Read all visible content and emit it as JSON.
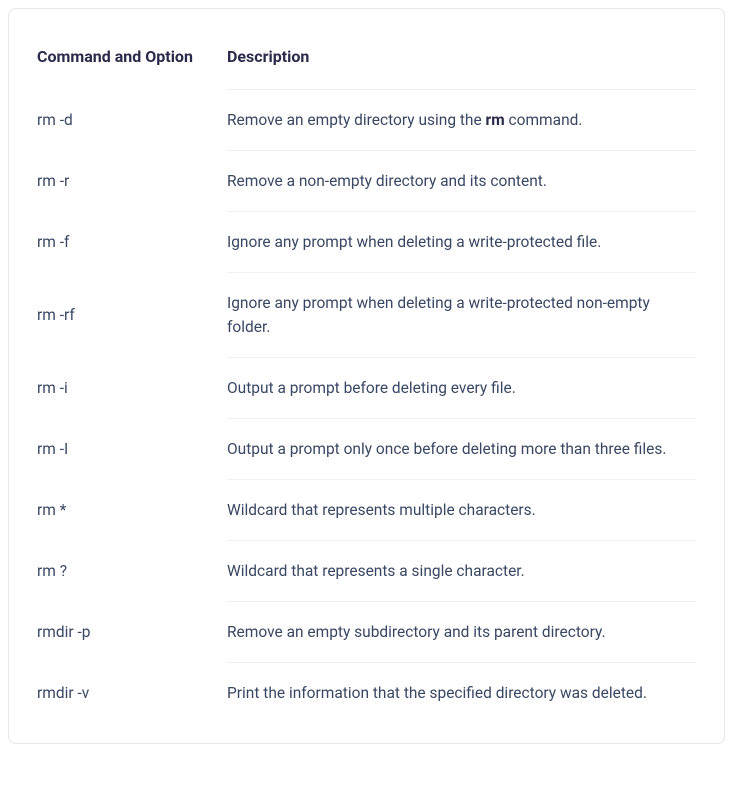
{
  "headers": {
    "command": "Command and Option",
    "description": "Description"
  },
  "rows": [
    {
      "command": "rm -d",
      "desc_pre": "Remove an empty directory using the ",
      "desc_bold": "rm",
      "desc_post": " command."
    },
    {
      "command": "rm -r",
      "desc_pre": "Remove a non-empty directory and its content.",
      "desc_bold": "",
      "desc_post": ""
    },
    {
      "command": "rm -f",
      "desc_pre": "Ignore any prompt when deleting a write-protected file.",
      "desc_bold": "",
      "desc_post": ""
    },
    {
      "command": "rm -rf",
      "desc_pre": "Ignore any prompt when deleting a write-protected non-empty folder.",
      "desc_bold": "",
      "desc_post": ""
    },
    {
      "command": "rm -i",
      "desc_pre": "Output a prompt before deleting every file.",
      "desc_bold": "",
      "desc_post": ""
    },
    {
      "command": "rm -I",
      "desc_pre": "Output a prompt only once before deleting more than three files.",
      "desc_bold": "",
      "desc_post": ""
    },
    {
      "command": "rm *",
      "desc_pre": "Wildcard that represents multiple characters.",
      "desc_bold": "",
      "desc_post": ""
    },
    {
      "command": "rm ?",
      "desc_pre": "Wildcard that represents a single character.",
      "desc_bold": "",
      "desc_post": ""
    },
    {
      "command": "rmdir -p",
      "desc_pre": "Remove an empty subdirectory and its parent directory.",
      "desc_bold": "",
      "desc_post": ""
    },
    {
      "command": "rmdir -v",
      "desc_pre": "Print the information that the specified directory was deleted.",
      "desc_bold": "",
      "desc_post": ""
    }
  ]
}
